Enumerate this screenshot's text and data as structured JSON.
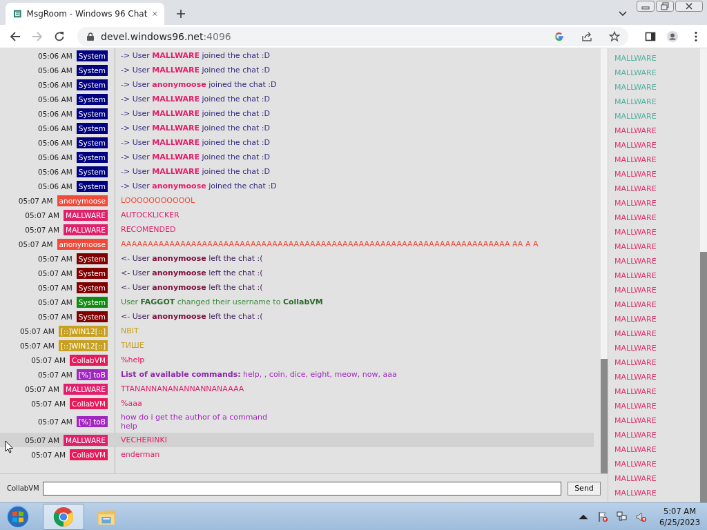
{
  "browser": {
    "tab": {
      "title": "MsgRoom - Windows 96 Chat"
    },
    "address": {
      "host": "devel.windows96.net",
      "port": ":4096"
    }
  },
  "chat": {
    "messages": [
      {
        "time": "05:06 AM",
        "user": "System",
        "color": "#000080",
        "kind": "join",
        "text": "-> User **MALLWARE** joined the chat :D",
        "hovered": false
      },
      {
        "time": "05:06 AM",
        "user": "System",
        "color": "#000080",
        "kind": "join",
        "text": "-> User **MALLWARE** joined the chat :D",
        "hovered": false
      },
      {
        "time": "05:06 AM",
        "user": "System",
        "color": "#000080",
        "kind": "join",
        "text": "-> User **anonymoose** joined the chat :D",
        "hovered": false
      },
      {
        "time": "05:06 AM",
        "user": "System",
        "color": "#000080",
        "kind": "join",
        "text": "-> User **MALLWARE** joined the chat :D",
        "hovered": false
      },
      {
        "time": "05:06 AM",
        "user": "System",
        "color": "#000080",
        "kind": "join",
        "text": "-> User **MALLWARE** joined the chat :D",
        "hovered": false
      },
      {
        "time": "05:06 AM",
        "user": "System",
        "color": "#000080",
        "kind": "join",
        "text": "-> User **MALLWARE** joined the chat :D",
        "hovered": false
      },
      {
        "time": "05:06 AM",
        "user": "System",
        "color": "#000080",
        "kind": "join",
        "text": "-> User **MALLWARE** joined the chat :D",
        "hovered": false
      },
      {
        "time": "05:06 AM",
        "user": "System",
        "color": "#000080",
        "kind": "join",
        "text": "-> User **MALLWARE** joined the chat :D",
        "hovered": false
      },
      {
        "time": "05:06 AM",
        "user": "System",
        "color": "#000080",
        "kind": "join",
        "text": "-> User **MALLWARE** joined the chat :D",
        "hovered": false
      },
      {
        "time": "05:06 AM",
        "user": "System",
        "color": "#000080",
        "kind": "join",
        "text": "-> User **anonymoose** joined the chat :D",
        "hovered": false
      },
      {
        "time": "05:07 AM",
        "user": "anonymoose",
        "color": "#f04a3a",
        "kind": "chat",
        "text": "LOOOOOOOOOOOL",
        "hovered": false
      },
      {
        "time": "05:07 AM",
        "user": "MALLWARE",
        "color": "#e0206a",
        "kind": "chat",
        "text": "AUTOCKLICKER",
        "hovered": false
      },
      {
        "time": "05:07 AM",
        "user": "MALLWARE",
        "color": "#e0206a",
        "kind": "chat",
        "text": "RECOMENDED",
        "hovered": false
      },
      {
        "time": "05:07 AM",
        "user": "anonymoose",
        "color": "#f04a3a",
        "kind": "chat",
        "text": "AAAAAAAAAAAAAAAAAAAAAAAAAAAAAAAAAAAAAAAAAAAAAAAAAAAAAAAAAAAAAAAAAAAAAAAA  AA A  A",
        "hovered": false
      },
      {
        "time": "05:07 AM",
        "user": "System",
        "color": "#800000",
        "kind": "leave",
        "text": "<- User **anonymoose** left the chat :(",
        "hovered": false
      },
      {
        "time": "05:07 AM",
        "user": "System",
        "color": "#800000",
        "kind": "leave",
        "text": "<- User **anonymoose** left the chat :(",
        "hovered": false
      },
      {
        "time": "05:07 AM",
        "user": "System",
        "color": "#800000",
        "kind": "leave",
        "text": "<- User **anonymoose** left the chat :(",
        "hovered": false
      },
      {
        "time": "05:07 AM",
        "user": "System",
        "color": "#108a10",
        "kind": "rename",
        "text": "User **FAGGOT** changed their username to **CollabVM**",
        "hovered": false
      },
      {
        "time": "05:07 AM",
        "user": "System",
        "color": "#800000",
        "kind": "leave",
        "text": "<- User **anonymoose** left the chat :(",
        "hovered": false
      },
      {
        "time": "05:07 AM",
        "user": "[::]WIN12[::]",
        "color": "#c8a020",
        "kind": "chat",
        "text": "NBIT",
        "hovered": false
      },
      {
        "time": "05:07 AM",
        "user": "[::]WIN12[::]",
        "color": "#c8a020",
        "kind": "chat",
        "text": "ТИШЕ",
        "hovered": false
      },
      {
        "time": "05:07 AM",
        "user": "CollabVM",
        "color": "#e8185a",
        "kind": "chat",
        "text": "%help",
        "hovered": false
      },
      {
        "time": "05:07 AM",
        "user": "[%] toB",
        "color": "#a028c0",
        "kind": "chat",
        "text": "**List of available commands:** help, , coin, dice, eight, meow, now, aaa",
        "hovered": false
      },
      {
        "time": "05:07 AM",
        "user": "MALLWARE",
        "color": "#e0206a",
        "kind": "chat",
        "text": "TTANANNANANANNANNANAAAA",
        "hovered": false
      },
      {
        "time": "05:07 AM",
        "user": "CollabVM",
        "color": "#e8185a",
        "kind": "chat",
        "text": "%aaa",
        "hovered": false
      },
      {
        "time": "05:07 AM",
        "user": "[%] toB",
        "color": "#a028c0",
        "kind": "chat",
        "text": "how do i get the author of a command\nhelp",
        "hovered": false
      },
      {
        "time": "05:07 AM",
        "user": "MALLWARE",
        "color": "#e0206a",
        "kind": "chat",
        "text": "VECHERINKI",
        "hovered": true
      },
      {
        "time": "05:07 AM",
        "user": "CollabVM",
        "color": "#e8185a",
        "kind": "chat",
        "text": "enderman",
        "hovered": false
      }
    ]
  },
  "composer": {
    "name": "CollabVM",
    "send": "Send"
  },
  "user_list": [
    {
      "name": "MALLWARE",
      "color": "#50b0a0"
    },
    {
      "name": "MALLWARE",
      "color": "#50b0a0"
    },
    {
      "name": "MALLWARE",
      "color": "#50b0a0"
    },
    {
      "name": "MALLWARE",
      "color": "#50b0a0"
    },
    {
      "name": "MALLWARE",
      "color": "#50b0a0"
    },
    {
      "name": "MALLWARE",
      "color": "#e0306a"
    },
    {
      "name": "MALLWARE",
      "color": "#e0306a"
    },
    {
      "name": "MALLWARE",
      "color": "#e0306a"
    },
    {
      "name": "MALLWARE",
      "color": "#e0306a"
    },
    {
      "name": "MALLWARE",
      "color": "#e0306a"
    },
    {
      "name": "MALLWARE",
      "color": "#e0306a"
    },
    {
      "name": "MALLWARE",
      "color": "#e0306a"
    },
    {
      "name": "MALLWARE",
      "color": "#e0306a"
    },
    {
      "name": "MALLWARE",
      "color": "#e0306a"
    },
    {
      "name": "MALLWARE",
      "color": "#e0306a"
    },
    {
      "name": "MALLWARE",
      "color": "#e0306a"
    },
    {
      "name": "MALLWARE",
      "color": "#e0306a"
    },
    {
      "name": "MALLWARE",
      "color": "#e0306a"
    },
    {
      "name": "MALLWARE",
      "color": "#e0306a"
    },
    {
      "name": "MALLWARE",
      "color": "#e0306a"
    },
    {
      "name": "MALLWARE",
      "color": "#e0306a"
    },
    {
      "name": "MALLWARE",
      "color": "#e0306a"
    },
    {
      "name": "MALLWARE",
      "color": "#e0306a"
    },
    {
      "name": "MALLWARE",
      "color": "#e0306a"
    },
    {
      "name": "MALLWARE",
      "color": "#e0306a"
    },
    {
      "name": "MALLWARE",
      "color": "#e0306a"
    },
    {
      "name": "MALLWARE",
      "color": "#e0306a"
    },
    {
      "name": "MALLWARE",
      "color": "#e0306a"
    },
    {
      "name": "MALLWARE",
      "color": "#e0306a"
    },
    {
      "name": "MALLWARE",
      "color": "#e0306a"
    },
    {
      "name": "MALLWARE",
      "color": "#e0306a"
    }
  ],
  "taskbar": {
    "apps": [
      {
        "kind": "chrome",
        "selected": true
      },
      {
        "kind": "explorer",
        "selected": false
      }
    ],
    "clock": {
      "time": "5:07 AM",
      "date": "6/25/2023"
    }
  }
}
